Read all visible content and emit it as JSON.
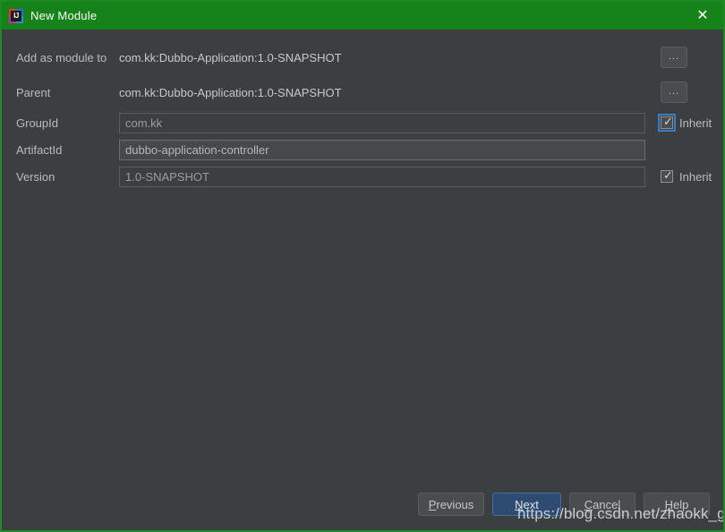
{
  "window": {
    "title": "New Module",
    "icon": "intellij-idea-icon",
    "icon_text": "IJ",
    "close_label": "✕",
    "titlebar_color": "#15821a",
    "border_color": "#1f8a22",
    "background_color": "#3c3f41"
  },
  "form": {
    "rows": [
      {
        "label": "Add as module to",
        "value": "com.kk:Dubbo-Application:1.0-SNAPSHOT",
        "browse_label": "...",
        "kind": "static-with-browse"
      },
      {
        "label": "Parent",
        "value": "com.kk:Dubbo-Application:1.0-SNAPSHOT",
        "browse_label": "...",
        "kind": "static-with-browse"
      },
      {
        "label": "GroupId",
        "value": "com.kk",
        "kind": "input-with-inherit",
        "inherit_label": "Inherit",
        "inherit_checked": true,
        "inherit_focused": true,
        "enabled": false
      },
      {
        "label": "ArtifactId",
        "value": "dubbo-application-controller",
        "kind": "input",
        "enabled": true
      },
      {
        "label": "Version",
        "value": "1.0-SNAPSHOT",
        "kind": "input-with-inherit",
        "inherit_label": "Inherit",
        "inherit_checked": true,
        "inherit_focused": false,
        "enabled": false
      }
    ]
  },
  "footer": {
    "previous": {
      "label": "Previous",
      "mnemonic": "P"
    },
    "next": {
      "label": "Next",
      "mnemonic": "N",
      "default": true,
      "accent_color": "#2e4b72"
    },
    "cancel": {
      "label": "Cancel",
      "mnemonic": "C"
    },
    "help": {
      "label": "Help",
      "mnemonic": "H"
    }
  },
  "watermark": {
    "text": "https://blog.csdn.net/zhaokk_git"
  }
}
